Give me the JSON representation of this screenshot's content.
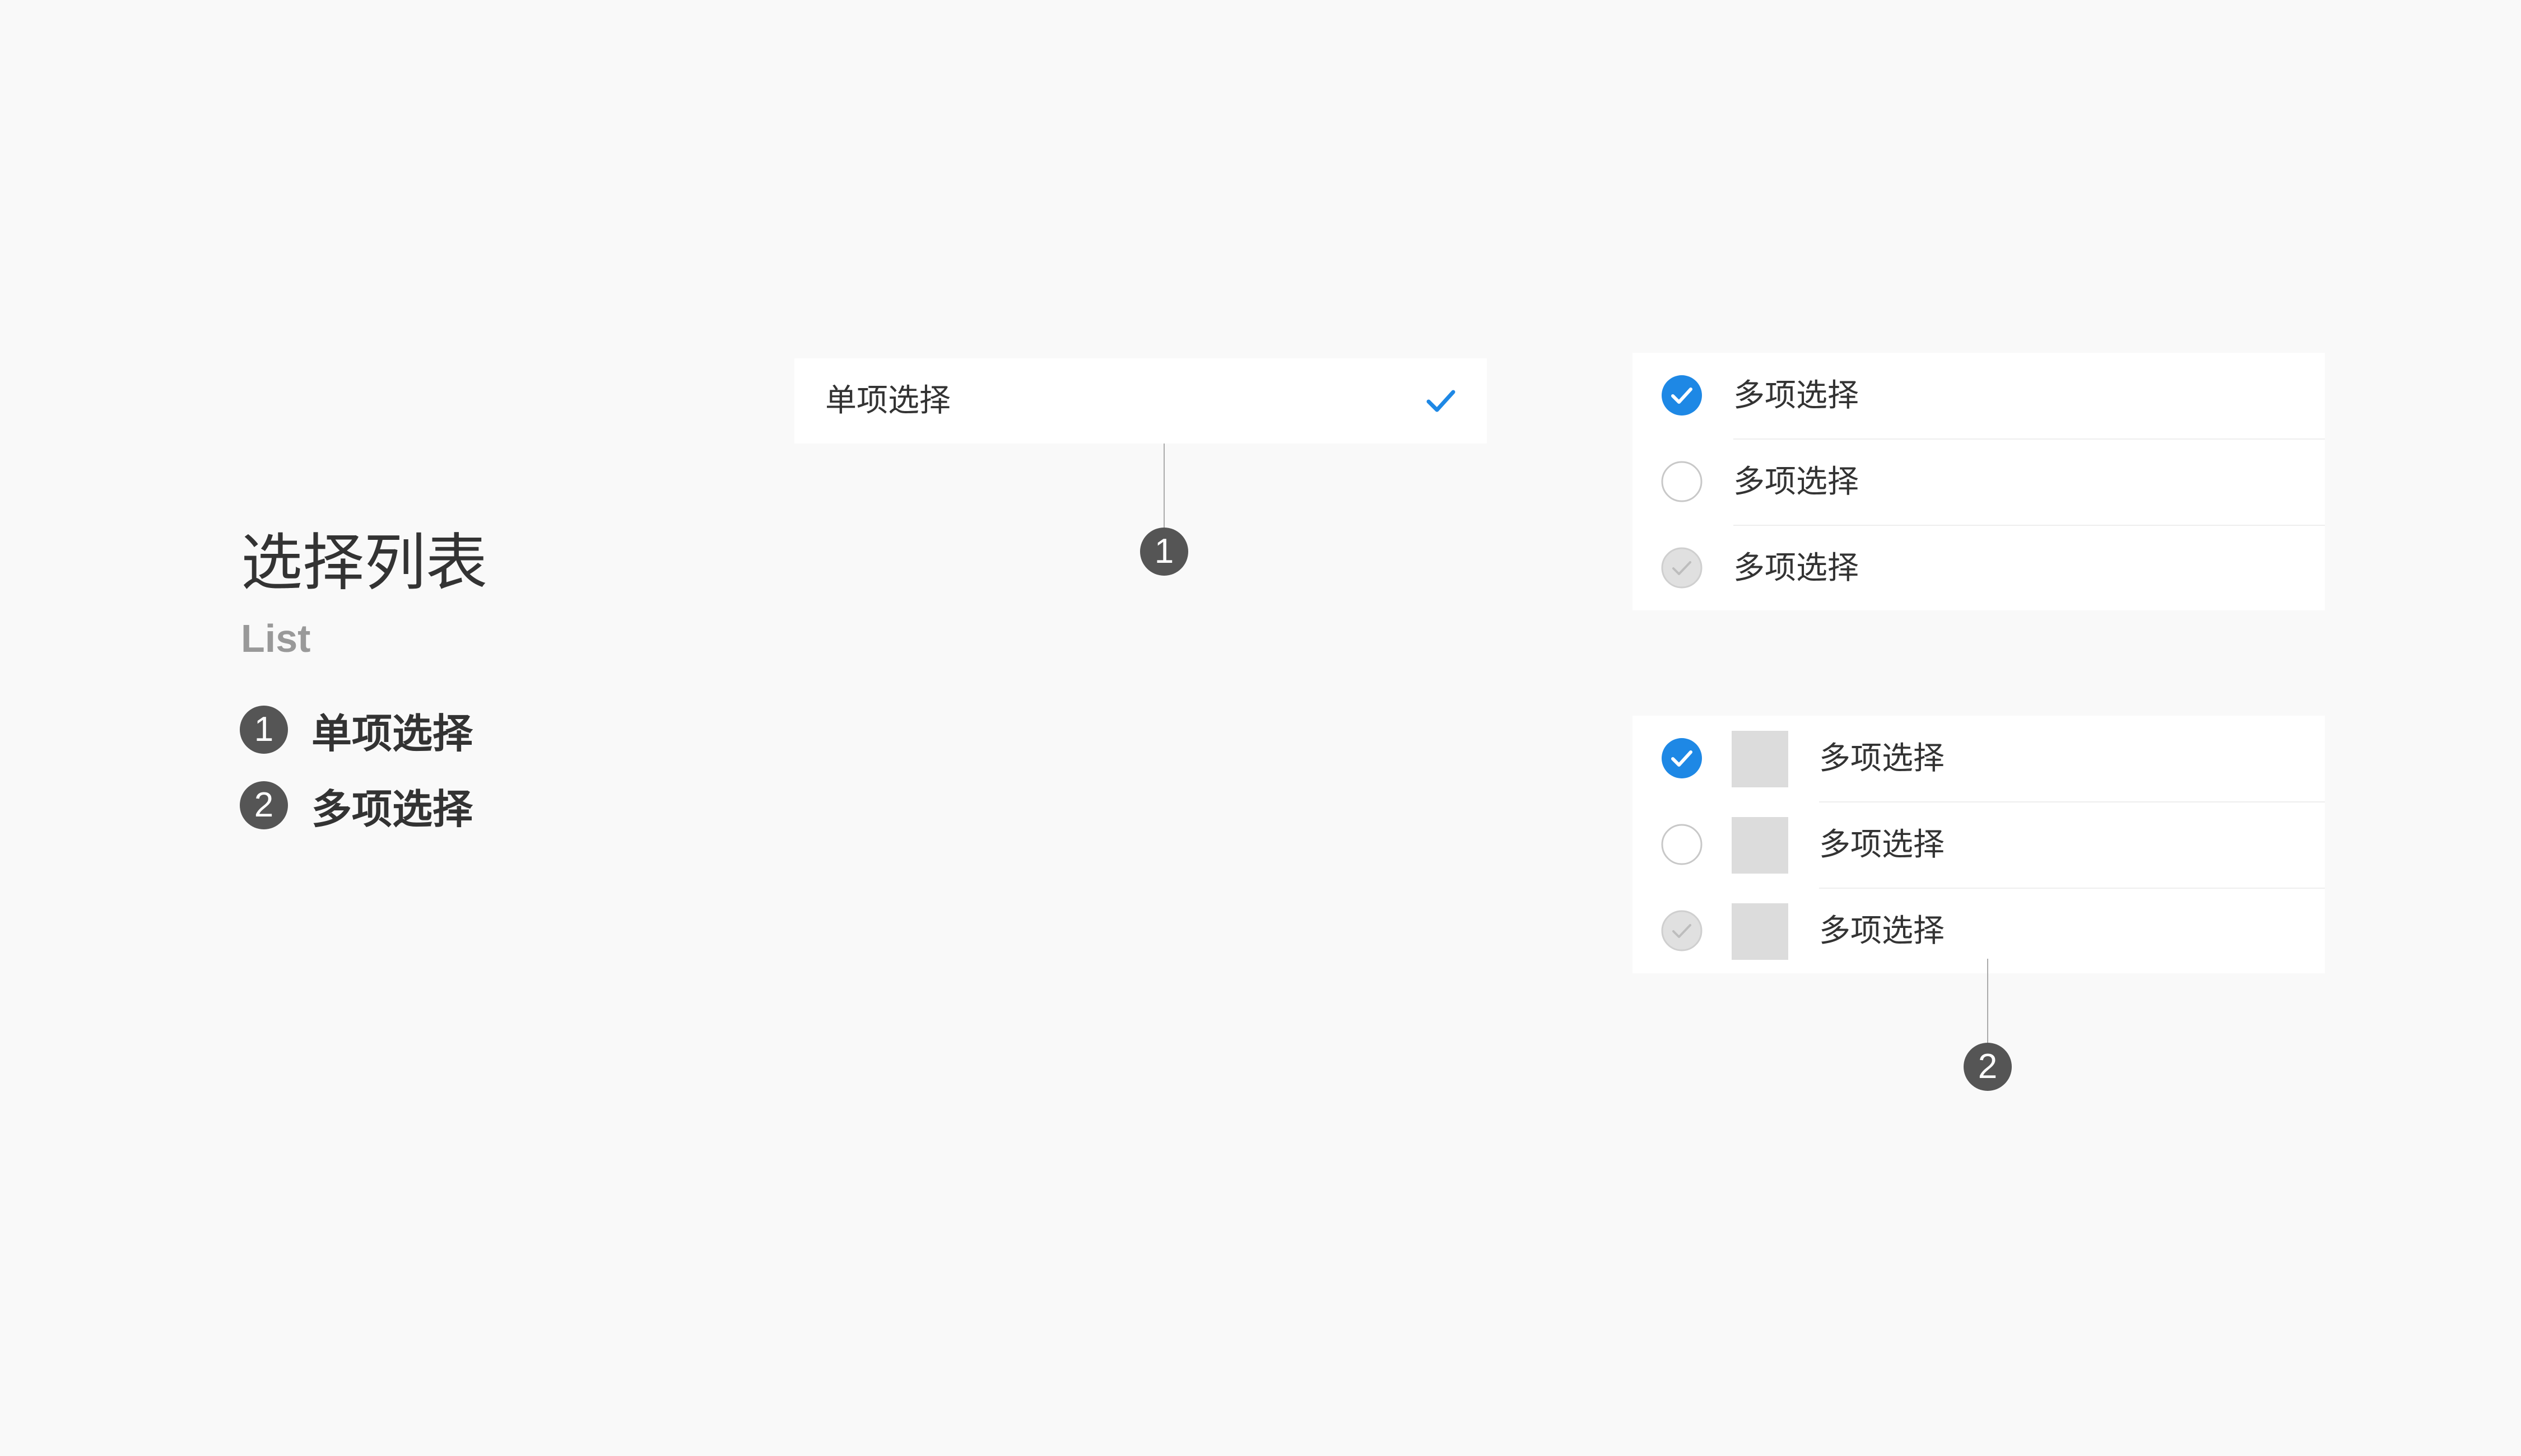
{
  "legend": {
    "title": "选择列表",
    "subtitle": "List",
    "items": [
      {
        "number": "1",
        "label": "单项选择"
      },
      {
        "number": "2",
        "label": "多项选择"
      }
    ]
  },
  "single_select": {
    "label": "单项选择",
    "selected": true
  },
  "multi_select_list": {
    "rows": [
      {
        "label": "多项选择",
        "state": "checked"
      },
      {
        "label": "多项选择",
        "state": "unchecked"
      },
      {
        "label": "多项选择",
        "state": "disabled-checked"
      }
    ]
  },
  "multi_select_list_with_thumbnails": {
    "rows": [
      {
        "label": "多项选择",
        "state": "checked"
      },
      {
        "label": "多项选择",
        "state": "unchecked"
      },
      {
        "label": "多项选择",
        "state": "disabled-checked"
      }
    ]
  },
  "callouts": [
    {
      "number": "1"
    },
    {
      "number": "2"
    }
  ],
  "colors": {
    "accent": "#1e88e5",
    "background": "#f9f9f9",
    "badge": "#555555",
    "thumbnail": "#dcdcdc",
    "disabled_circle": "#e0e0e0"
  },
  "icons": {
    "checked": "checkmark-circle-filled-icon",
    "unchecked": "empty-circle-icon",
    "disabled_checked": "checkmark-circle-disabled-icon",
    "single_selected": "checkmark-icon"
  }
}
